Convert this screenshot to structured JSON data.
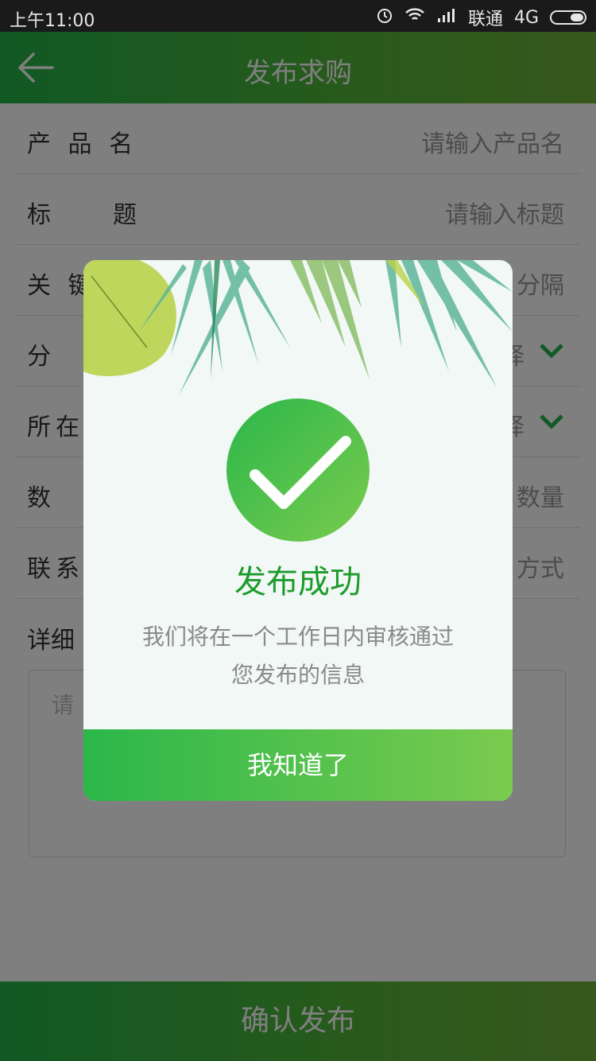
{
  "status_bar": {
    "time": "上午11:00",
    "carrier": "联通",
    "network": "4G"
  },
  "header": {
    "title": "发布求购",
    "back_icon": "arrow-left-icon"
  },
  "form": {
    "rows": [
      {
        "label": "产 品 名",
        "placeholder": "请输入产品名"
      },
      {
        "label": "标　　题",
        "placeholder": "请输入标题"
      },
      {
        "label": "关 键",
        "placeholder": "分隔"
      },
      {
        "label": "分",
        "placeholder": "择"
      },
      {
        "label": "所在",
        "placeholder": "择"
      },
      {
        "label": "数",
        "placeholder": "数量"
      },
      {
        "label": "联系",
        "placeholder": "方式"
      }
    ],
    "detail_label": "详细",
    "detail_placeholder": "请",
    "submit_label": "确认发布"
  },
  "modal": {
    "title": "发布成功",
    "message_line1": "我们将在一个工作日内审核通过",
    "message_line2": "您发布的信息",
    "button_label": "我知道了"
  },
  "colors": {
    "brand_green": "#23b24a",
    "success_title": "#1d9b2d"
  }
}
